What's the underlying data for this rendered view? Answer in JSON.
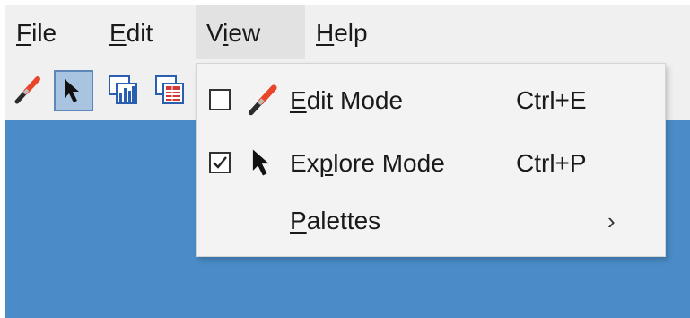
{
  "menubar": {
    "items": [
      {
        "pre": "",
        "ul": "F",
        "post": "ile"
      },
      {
        "pre": "",
        "ul": "E",
        "post": "dit"
      },
      {
        "pre": "V",
        "ul": "i",
        "post": "ew"
      },
      {
        "pre": "",
        "ul": "H",
        "post": "elp"
      }
    ]
  },
  "toolbar": {
    "buttons": [
      {
        "icon": "paintbrush-icon",
        "pressed": false
      },
      {
        "icon": "arrow-pointer-icon",
        "pressed": true
      },
      {
        "icon": "bar-chart-palette-icon",
        "pressed": false
      },
      {
        "icon": "table-palette-icon",
        "pressed": false
      }
    ]
  },
  "view_menu": {
    "items": [
      {
        "pre": "",
        "ul": "E",
        "post": "dit Mode",
        "shortcut": "Ctrl+E",
        "checked": false,
        "icon": "paintbrush-icon"
      },
      {
        "pre": "Ex",
        "ul": "p",
        "post": "lore Mode",
        "shortcut": "Ctrl+P",
        "checked": true,
        "icon": "arrow-pointer-icon"
      },
      {
        "pre": "",
        "ul": "P",
        "post": "alettes",
        "submenu_arrow": "›",
        "icon": "none"
      }
    ]
  },
  "colors": {
    "menubar_bg": "#f0f0f0",
    "workspace": "#4b8cc8",
    "pressed_button": "#a8c4e0",
    "brush_tip": "#e8452a"
  }
}
